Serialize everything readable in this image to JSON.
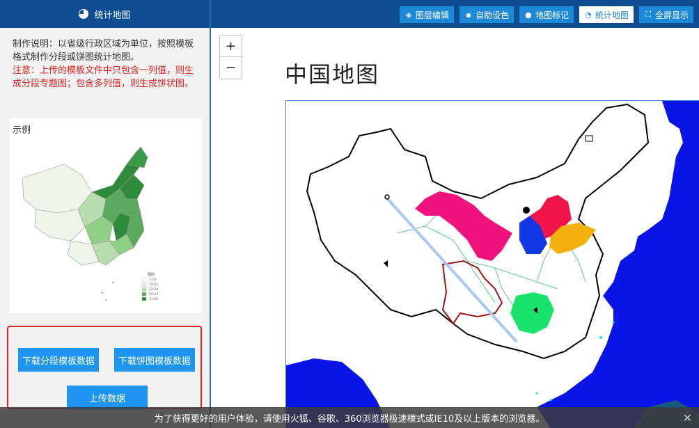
{
  "sidebar": {
    "title": "统计地图",
    "description": "制作说明：以省级行政区域为单位，按照模板格式制作分段或饼图统计地图。",
    "note": "注意：上传的模板文件中只包含一列值，则生成分段专题图；包含多列值，则生成饼状图。",
    "example_label": "示例",
    "legend_title": "图例",
    "legend": [
      "7-14",
      "14-22",
      "22-29",
      "29-37",
      "37-45"
    ],
    "buttons": {
      "download_segment": "下载分段模板数据",
      "download_pie": "下载饼图模板数据",
      "upload": "上传数据"
    }
  },
  "toolbar": {
    "items": [
      {
        "label": "图层编辑",
        "icon": "layers-icon"
      },
      {
        "label": "自助设色",
        "icon": "palette-icon"
      },
      {
        "label": "地图标记",
        "icon": "marker-icon"
      },
      {
        "label": "统计地图",
        "icon": "pie-chart-icon",
        "active": true
      },
      {
        "label": "全屏显示",
        "icon": "fullscreen-icon"
      }
    ]
  },
  "map": {
    "title": "中国地图",
    "zoom_in": "+",
    "zoom_out": "−",
    "colors": {
      "sea": "#0a14e6",
      "land": "#ffffff",
      "magenta": "#f0137e",
      "red": "#f2154a",
      "blue": "#1238e6",
      "orange": "#f2b10d",
      "green": "#19e36b",
      "dark_red_border": "#9c1414",
      "route": "#a8c8f0"
    }
  },
  "notice": {
    "text": "为了获得更好的用户体验，请使用火狐、谷歌、360浏览器极速模式或IE10及以上版本的浏览器。",
    "close": "✕"
  }
}
